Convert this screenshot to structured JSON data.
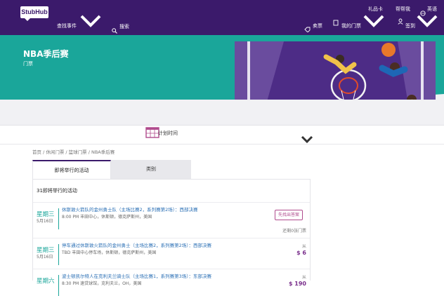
{
  "header": {
    "logo": "StubHub",
    "explore": "查找事件",
    "search": "搜索",
    "sell": "卖票",
    "my_tickets": "我的门票",
    "gift_card": "礼品卡",
    "help": "帮帮我",
    "signin": "签到",
    "language": "英语"
  },
  "hero": {
    "title": "NBA季后赛",
    "subtitle": "门票"
  },
  "schedule": {
    "label": "计划时间"
  },
  "breadcrumb": [
    "首页",
    "休闲门票",
    "篮球门票",
    "NBA季后赛"
  ],
  "tabs": {
    "upcoming": "即将举行的活动",
    "category": "类别"
  },
  "list": {
    "count_label": "31即将举行的活动",
    "events": [
      {
        "day": "星期三",
        "date": "5月16日",
        "title": "休斯敦火箭队的金州勇士队（主场比赛2，系列赛第2场）：西部决赛",
        "meta": "8:00 PM  丰田中心，休斯顿，德克萨斯州，美国",
        "action": "先找出答案",
        "action_sub": "还剩0张门票"
      },
      {
        "day": "星期三",
        "date": "5月16日",
        "title": "停车通过休斯敦火箭队的金州勇士（主场比赛2，系列赛第2场）：西部决赛",
        "meta": "TBD  丰田中心停车场，休斯顿，德克萨斯州，美国",
        "from": "从",
        "price": "$ 6"
      },
      {
        "day": "星期六",
        "date": "",
        "title": "波士顿凯尔特人在克利夫兰骑士队（主场比赛1，系列赛第3场）：东部决赛",
        "meta": "8:30 PM  速贷球馆，克利夫兰，OH，美国",
        "from": "从",
        "price": "$ 190"
      }
    ]
  },
  "colors": {
    "brand": "#3b1a6b",
    "teal": "#1aa69a",
    "accent": "#b04b8d"
  }
}
